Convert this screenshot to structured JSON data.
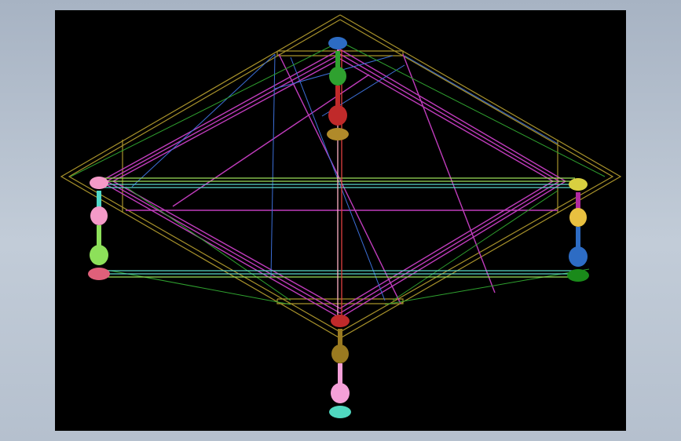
{
  "app": {
    "background_colors": {
      "top": "#a7b3c3",
      "bottom": "#b5c0ce"
    },
    "viewport_background": "#000000"
  },
  "model": {
    "description_visible_text": "",
    "colors": {
      "outline": "#a8922b",
      "frame_magenta": "#c03cbc",
      "brace_blue": "#3c6fd8",
      "brace_green": "#2fa12f",
      "rail_green": "#9be05a",
      "rail_cyan": "#5ad6c8",
      "pink_rail": "#ffb3c6",
      "red_rail": "#e04040"
    },
    "legs": [
      {
        "id": "leg-back",
        "colors": [
          "#2d6cc4",
          "#2fa12f",
          "#2fa12f",
          "#c02a2a",
          "#c02a2a",
          "#b08a2a"
        ]
      },
      {
        "id": "leg-left",
        "colors": [
          "#f49ac8",
          "#4fd8c8",
          "#f49ac8",
          "#8de05a",
          "#8de05a",
          "#e0607a"
        ]
      },
      {
        "id": "leg-right",
        "colors": [
          "#d8d040",
          "#b02aa0",
          "#e8c040",
          "#2d6cc4",
          "#2d6cc4",
          "#1a8a1a"
        ]
      },
      {
        "id": "leg-front",
        "colors": [
          "#c02a2a",
          "#9a7a20",
          "#9a7a20",
          "#f4a0d8",
          "#f4a0d8",
          "#50d8c0"
        ]
      }
    ]
  }
}
